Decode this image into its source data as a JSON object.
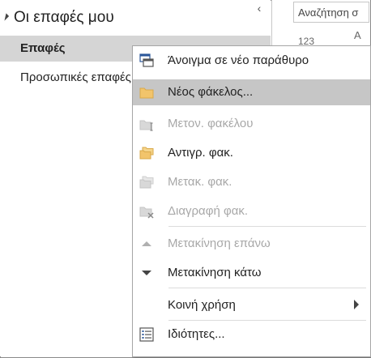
{
  "nav": {
    "header_title": "Οι επαφές μου",
    "items": [
      {
        "label": "Επαφές"
      },
      {
        "label": "Προσωπικές επαφές"
      }
    ]
  },
  "right_pane": {
    "search_placeholder": "Αναζήτηση σ",
    "text1": "123",
    "text2": "Α"
  },
  "context_menu": {
    "items": [
      {
        "label": "Άνοιγμα σε νέο παράθυρο",
        "icon": "open-window-icon",
        "disabled": false
      },
      {
        "label": "Νέος φάκελος...",
        "icon": "new-folder-icon",
        "disabled": false,
        "highlighted": true
      },
      {
        "label": "Μετον. φακέλου",
        "icon": "rename-folder-icon",
        "disabled": true
      },
      {
        "label": "Αντιγρ. φακ.",
        "icon": "copy-folder-icon",
        "disabled": false
      },
      {
        "label": "Μετακ. φακ.",
        "icon": "move-folder-icon",
        "disabled": true
      },
      {
        "label": "Διαγραφή φακ.",
        "icon": "delete-folder-icon",
        "disabled": true
      },
      {
        "label": "Μετακίνηση επάνω",
        "icon": "move-up-icon",
        "disabled": true
      },
      {
        "label": "Μετακίνηση κάτω",
        "icon": "move-down-icon",
        "disabled": false
      },
      {
        "label": "Κοινή χρήση",
        "icon": "",
        "disabled": false,
        "submenu": true
      },
      {
        "label": "Ιδιότητες...",
        "icon": "properties-icon",
        "disabled": false
      }
    ]
  },
  "colors": {
    "selected_nav": "#d5d5d5",
    "menu_highlight": "#c6c6c6",
    "disabled_text": "#a8a8a8",
    "folder_yellow": "#f2c46b"
  }
}
